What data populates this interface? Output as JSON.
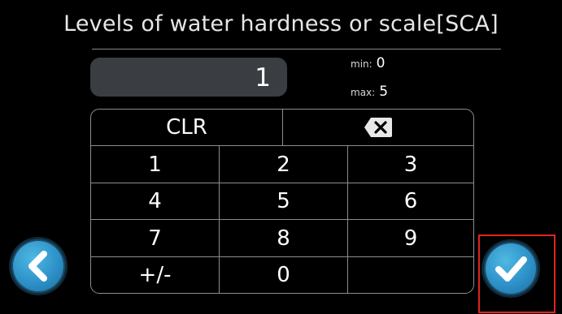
{
  "title": "Levels of water hardness or scale[SCA]",
  "input": {
    "value": "1"
  },
  "range": {
    "min_label": "min:",
    "min_value": "0",
    "max_label": "max:",
    "max_value": "5"
  },
  "keypad": {
    "clear": "CLR",
    "backspace_icon": "backspace-icon",
    "digits": [
      "1",
      "2",
      "3",
      "4",
      "5",
      "6",
      "7",
      "8",
      "9"
    ],
    "sign": "+/-",
    "zero": "0"
  },
  "nav": {
    "back_icon": "chevron-left-icon",
    "confirm_icon": "checkmark-icon"
  },
  "colors": {
    "accent": "#2c8fc6",
    "highlight": "#e0231e",
    "display_bg": "#3a3d42"
  }
}
